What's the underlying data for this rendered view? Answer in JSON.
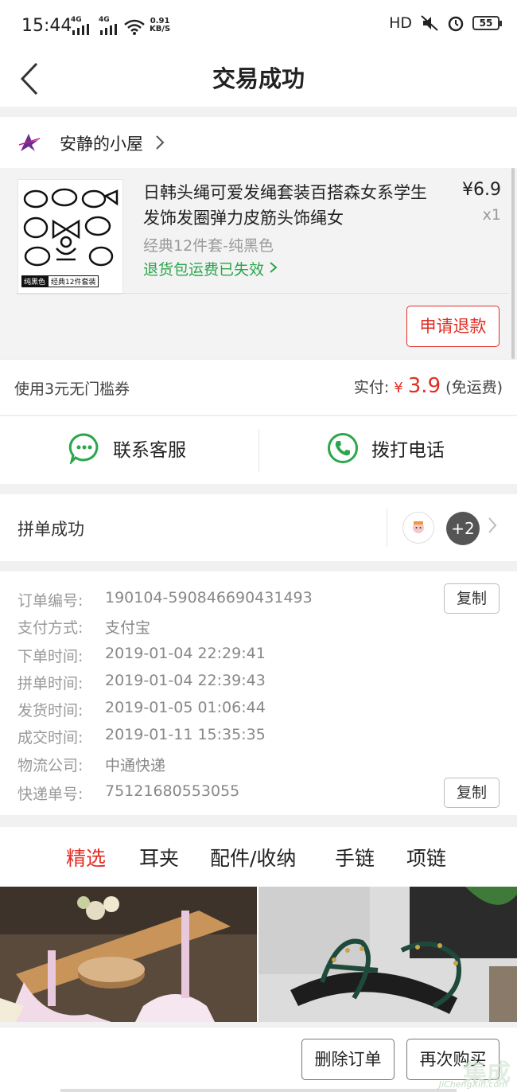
{
  "status": {
    "time": "15:44",
    "signal1": "4G",
    "signal2": "4G",
    "speed_value": "0.91",
    "speed_unit": "KB/S",
    "hd": "HD",
    "battery": "55"
  },
  "nav": {
    "title": "交易成功"
  },
  "shop": {
    "name": "安静的小屋"
  },
  "product": {
    "title": "日韩头绳可爱发绳套装百搭森女系学生发饰发圈弹力皮筋头饰绳女",
    "price": "¥6.9",
    "qty": "x1",
    "spec": "经典12件套-纯黑色",
    "return_note": "退货包运费已失效",
    "thumb_tag_black": "纯黑色",
    "thumb_tag_set": "经典12件套装",
    "refund_label": "申请退款"
  },
  "payment": {
    "coupon": "使用3元无门槛券",
    "paid_label": "实付:",
    "currency": "¥",
    "amount": "3.9",
    "shipping": "(免运费)"
  },
  "contact": {
    "service": "联系客服",
    "phone": "拨打电话"
  },
  "group": {
    "label": "拼单成功",
    "extra": "+2"
  },
  "details": {
    "rows": [
      {
        "label": "订单编号:",
        "value": "190104-590846690431493"
      },
      {
        "label": "支付方式:",
        "value": "支付宝"
      },
      {
        "label": "下单时间:",
        "value": "2019-01-04 22:29:41"
      },
      {
        "label": "拼单时间:",
        "value": "2019-01-04 22:39:43"
      },
      {
        "label": "发货时间:",
        "value": "2019-01-05 01:06:44"
      },
      {
        "label": "成交时间:",
        "value": "2019-01-11 15:35:35"
      },
      {
        "label": "物流公司:",
        "value": "中通快递"
      },
      {
        "label": "快递单号:",
        "value": "75121680553055"
      }
    ],
    "copy_label": "复制"
  },
  "recommend": {
    "tabs": [
      "精选",
      "耳夹",
      "配件/收纳",
      "手链",
      "项链"
    ],
    "active_tab": 0
  },
  "bottom": {
    "delete_label": "删除订单",
    "rebuy_label": "再次购买"
  },
  "watermark": {
    "cn": "集成",
    "en": "JiChengXin.com"
  },
  "colors": {
    "accent_red": "#e02e24",
    "green": "#2aa64b"
  }
}
